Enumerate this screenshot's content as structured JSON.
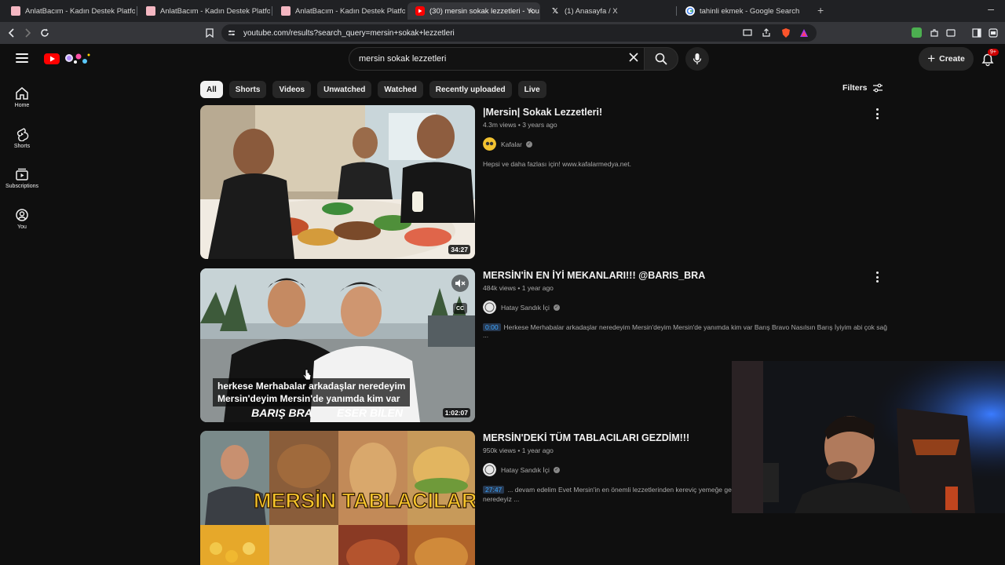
{
  "browser": {
    "tabs": [
      {
        "title": "AnlatBacım - Kadın Destek Platformu",
        "active": false
      },
      {
        "title": "AnlatBacım - Kadın Destek Platformu",
        "active": false
      },
      {
        "title": "AnlatBacım - Kadın Destek Platformu",
        "active": false
      },
      {
        "title": "(30) mersin sokak lezzetleri - You",
        "active": true
      },
      {
        "title": "(1) Anasayfa / X",
        "active": false
      },
      {
        "title": "tahinli ekmek - Google Search",
        "active": false
      }
    ],
    "close_glyph": "×",
    "new_tab_glyph": "+",
    "minimize_glyph": "–",
    "url": "youtube.com/results?search_query=mersin+sokak+lezzetleri"
  },
  "header": {
    "search_value": "mersin sokak lezzetleri",
    "create_label": "Create",
    "notification_count": "9+"
  },
  "sidebar": {
    "items": [
      {
        "label": "Home",
        "icon": "home-icon"
      },
      {
        "label": "Shorts",
        "icon": "shorts-icon"
      },
      {
        "label": "Subscriptions",
        "icon": "subscriptions-icon"
      },
      {
        "label": "You",
        "icon": "you-icon"
      }
    ]
  },
  "chips": [
    "All",
    "Shorts",
    "Videos",
    "Unwatched",
    "Watched",
    "Recently uploaded",
    "Live"
  ],
  "filters_label": "Filters",
  "results": [
    {
      "title": "|Mersin| Sokak Lezzetleri!",
      "meta": "4.3m views • 3 years ago",
      "channel": "Kafalar",
      "description": "Hepsi ve daha fazlası için! www.kafalarmedya.net.",
      "duration": "34:27"
    },
    {
      "title": "MERSİN'İN EN İYİ MEKANLARI!!! @BARIS_BRA",
      "meta": "484k views • 1 year ago",
      "channel": "Hatay Sandık İçi",
      "desc_timestamp": "0:00",
      "description": "Herkese Merhabalar arkadaşlar neredeyim Mersin'deyim Mersin'de yanımda kim var Barış Bravo Nasılsın Barış İyiyim abi çok sağ ...",
      "duration": "1:02:07",
      "caption_line1": "herkese Merhabalar arkadaşlar neredeyim",
      "caption_line2": "Mersin'deyim Mersin'de yanımda kim var",
      "thumb_text_left": "BARIŞ BRA",
      "thumb_text_right": "ESER BİLEN",
      "cc_label": "CC"
    },
    {
      "title": "MERSİN'DEKİ TÜM TABLACILARI GEZDİM!!!",
      "meta": "950k views • 1 year ago",
      "channel": "Hatay Sandık İçi",
      "desc_timestamp": "27:47",
      "description": "... devam edelim Evet Mersin'in en önemli lezzetlerinden kereviç yemeğe geld",
      "description_line2": "neredeyiz ...",
      "thumb_text": "MERSİN TABLACILARI"
    }
  ],
  "colors": {
    "background": "#0f0f0f",
    "youtube_red": "#ff0000",
    "link_blue": "#3ea6ff",
    "thumb_title_yellow": "#f7c52b"
  }
}
